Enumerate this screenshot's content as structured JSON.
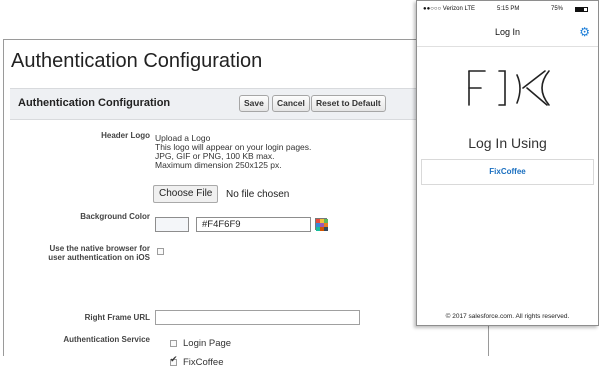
{
  "desktop": {
    "page_title": "Authentication Configuration",
    "section_title": "Authentication Configuration",
    "buttons": {
      "save": "Save",
      "cancel": "Cancel",
      "reset": "Reset to Default"
    },
    "header_logo": {
      "label": "Header Logo",
      "description": [
        "Upload a Logo",
        "This logo will appear on your login pages.",
        "JPG, GIF or PNG, 100 KB max.",
        "Maximum dimension 250x125 px."
      ],
      "choose_file": "Choose File",
      "no_file": "No file chosen"
    },
    "background_color": {
      "label": "Background Color",
      "value": "#F4F6F9"
    },
    "native_browser": {
      "label_line1": "Use the native browser for",
      "label_line2": "user authentication on iOS",
      "checked": false
    },
    "right_frame_url": {
      "label": "Right Frame URL",
      "value": ""
    },
    "auth_service": {
      "label": "Authentication Service",
      "options": [
        {
          "label": "Login Page",
          "checked": false
        },
        {
          "label": "FixCoffee",
          "checked": true
        }
      ]
    }
  },
  "phone": {
    "status": {
      "carrier": "●●○○○ Verizon  LTE",
      "time": "5:15 PM",
      "battery": "75%"
    },
    "nav_title": "Log In",
    "logo_text": "FIX",
    "login_using": "Log In Using",
    "provider_button": "FixCoffee",
    "footer": "© 2017 salesforce.com. All rights reserved.",
    "accent_color": "#1a7dd8"
  }
}
